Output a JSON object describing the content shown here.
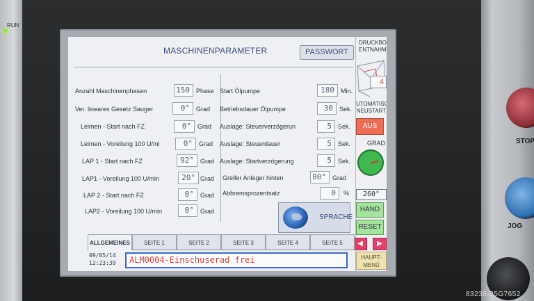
{
  "device": {
    "run_label": "RUN",
    "stop_label": "STOP",
    "jog_label": "JOG",
    "watermark": "83238-25G7652"
  },
  "screen": {
    "title": "MASCHINENPARAMETER",
    "passwort_button": "PASSWORT",
    "left_params": [
      {
        "label": "Anzahl Maschinenphasen",
        "value": "150",
        "unit": "Phase"
      },
      {
        "label": "Ver. lineares Gesetz Sauger",
        "value": "0°",
        "unit": "Grad"
      },
      {
        "label": "Leimen - Start nach FZ",
        "value": "0°",
        "unit": "Grad"
      },
      {
        "label": "Leimen - Voreilung 100 U/mi",
        "value": "0°",
        "unit": "Grad"
      },
      {
        "label": "LAP 1 - Start nach FZ",
        "value": "92°",
        "unit": "Grad"
      },
      {
        "label": "LAP1 - Voreilung 100 U/min",
        "value": "20°",
        "unit": "Grad"
      },
      {
        "label": "LAP 2 - Start nach FZ",
        "value": "0°",
        "unit": "Grad"
      },
      {
        "label": "LAP2 - Voreilung 100 U/min",
        "value": "0°",
        "unit": "Grad"
      }
    ],
    "right_params": [
      {
        "label": "Start Ölpumpe",
        "value": "180",
        "unit": "Min."
      },
      {
        "label": "Betriebsdauer Ölpumpe",
        "value": "30",
        "unit": "Sek."
      },
      {
        "label": "Auslage: Steuerverzögerun",
        "value": "5",
        "unit": "Sek."
      },
      {
        "label": "Auslage: Steuerdauer",
        "value": "5",
        "unit": "Sek."
      },
      {
        "label": "Auslage: Startverzögerung",
        "value": "5",
        "unit": "Sek."
      },
      {
        "label": "Greifer Anleger hinten",
        "value": "80°",
        "unit": "Grad"
      },
      {
        "label": "Abbremsprozentsatz",
        "value": "0",
        "unit": "%"
      }
    ],
    "sprache_button": "SPRACHE",
    "side": {
      "druckbog_line1": "DRUCKBOG.",
      "druckbog_line2": "ENTNAHME",
      "counter_value": "4",
      "auto_line1": "UTOMATISCHE",
      "auto_line2": "NEUSTART",
      "aus_button": "AUS",
      "grad_label": "GRAD",
      "angle_display": "260°",
      "hand_button": "HAND",
      "reset_button": "RESET",
      "prev_arrow": "◀",
      "next_arrow": "▶",
      "haupt_line1": "HAUPT-",
      "haupt_line2": "MENÜ"
    },
    "tabs": [
      "ALLGEMEINES",
      "SEITE 1",
      "SEITE 2",
      "SEITE 3",
      "SEITE 4",
      "SEITE 5"
    ],
    "active_tab": "ALLGEMEINES",
    "date": "09/05/14",
    "time": "12:23:39",
    "message": "ALM0004-Einschuserad frei"
  },
  "colors": {
    "screen_bg": "#eef0f4",
    "title_blue": "#3b4a80",
    "aus_orange": "#ee6d55",
    "status_green": "#a6e39e",
    "nav_pink": "#e6406a",
    "message_red": "#d0443a",
    "message_border": "#3a67d0"
  }
}
